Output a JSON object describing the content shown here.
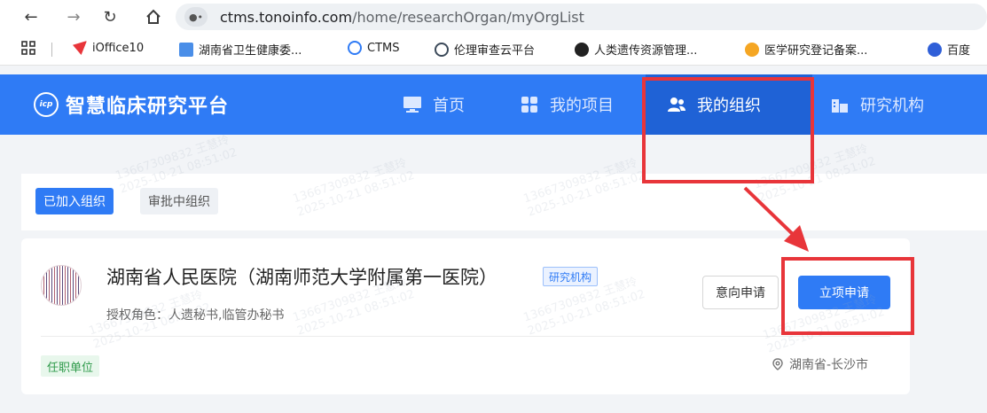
{
  "browser": {
    "url_domain": "ctms.tonoinfo.com",
    "url_path": "/home/researchOrgan/myOrgList",
    "bookmarks": [
      {
        "label": "iOffice10",
        "color": "#e8353a"
      },
      {
        "label": "湖南省卫生健康委...",
        "color": "#4a8ee8"
      },
      {
        "label": "CTMS",
        "color": "#2f7bf5"
      },
      {
        "label": "伦理审查云平台",
        "color": "#3c4a5a"
      },
      {
        "label": "人类遗传资源管理...",
        "color": "#222222"
      },
      {
        "label": "医学研究登记备案...",
        "color": "#f5a623"
      },
      {
        "label": "百度",
        "color": "#2f5fd8"
      }
    ]
  },
  "app": {
    "logo_mark": "icp",
    "title": "智慧临床研究平台",
    "nav": [
      {
        "label": "首页",
        "icon": "monitor-icon",
        "active": false
      },
      {
        "label": "我的项目",
        "icon": "grid-icon",
        "active": false
      },
      {
        "label": "我的组织",
        "icon": "users-icon",
        "active": true
      },
      {
        "label": "研究机构",
        "icon": "building-icon",
        "active": false
      }
    ]
  },
  "tabs": {
    "joined": "已加入组织",
    "pending": "审批中组织"
  },
  "org": {
    "name": "湖南省人民医院（湖南师范大学附属第一医院）",
    "badge": "研究机构",
    "role": "授权角色：人遗秘书,临管办秘书",
    "intent_button": "意向申请",
    "project_button": "立项申请",
    "employ_tag": "任职单位",
    "location": "湖南省-长沙市"
  },
  "watermark": {
    "line1": "13667309832 王慧玲",
    "line2": "2025-10-21 08:51:02"
  },
  "colors": {
    "brand": "#2f7bf5",
    "brand_active": "#1f62d6",
    "annotation": "#e8353a",
    "success": "#2e9a4a"
  }
}
